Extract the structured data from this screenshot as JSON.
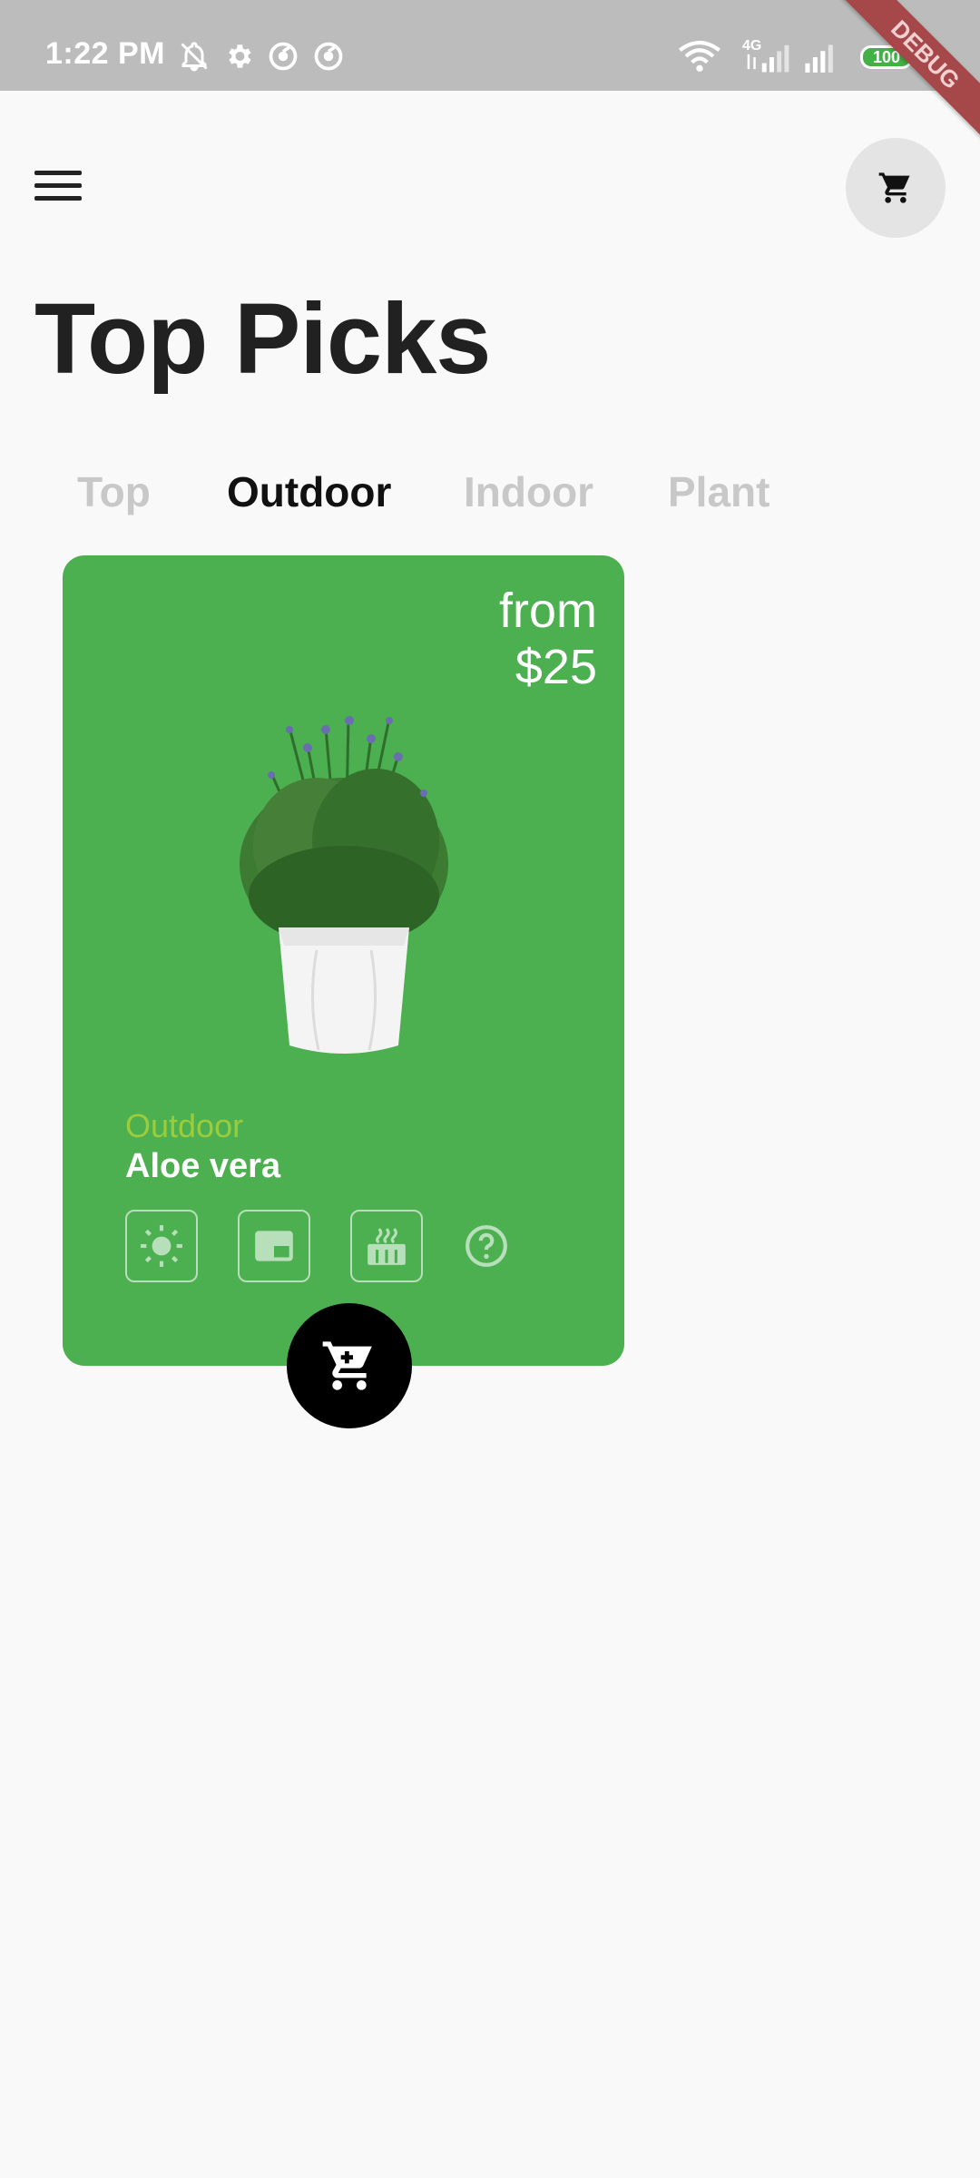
{
  "status_bar": {
    "time": "1:22 PM",
    "network_label": "4G",
    "battery_level": "100",
    "debug_label": "DEBUG",
    "icons": [
      "notifications-off-icon",
      "settings-icon",
      "sync-icon",
      "sync-icon",
      "wifi-icon",
      "signal-icon",
      "signal-icon",
      "battery-icon"
    ]
  },
  "header": {
    "menu_icon": "menu-icon",
    "cart_icon": "cart-icon",
    "title": "Top Picks"
  },
  "tabs": [
    {
      "label": "Top",
      "active": false
    },
    {
      "label": "Outdoor",
      "active": true
    },
    {
      "label": "Indoor",
      "active": false
    },
    {
      "label": "Plant",
      "active": false
    }
  ],
  "product": {
    "price_prefix": "from",
    "price": "$25",
    "category": "Outdoor",
    "name": "Aloe vera",
    "features": [
      "sun-icon",
      "window-icon",
      "temperature-icon",
      "help-icon"
    ],
    "card_color": "#4caf50",
    "category_color": "#9ccc3c"
  },
  "fab": {
    "icon": "add-to-cart-icon"
  },
  "colors": {
    "background": "#f9f9f9",
    "status_bar": "#bcbcbc",
    "accent": "#4caf50"
  }
}
